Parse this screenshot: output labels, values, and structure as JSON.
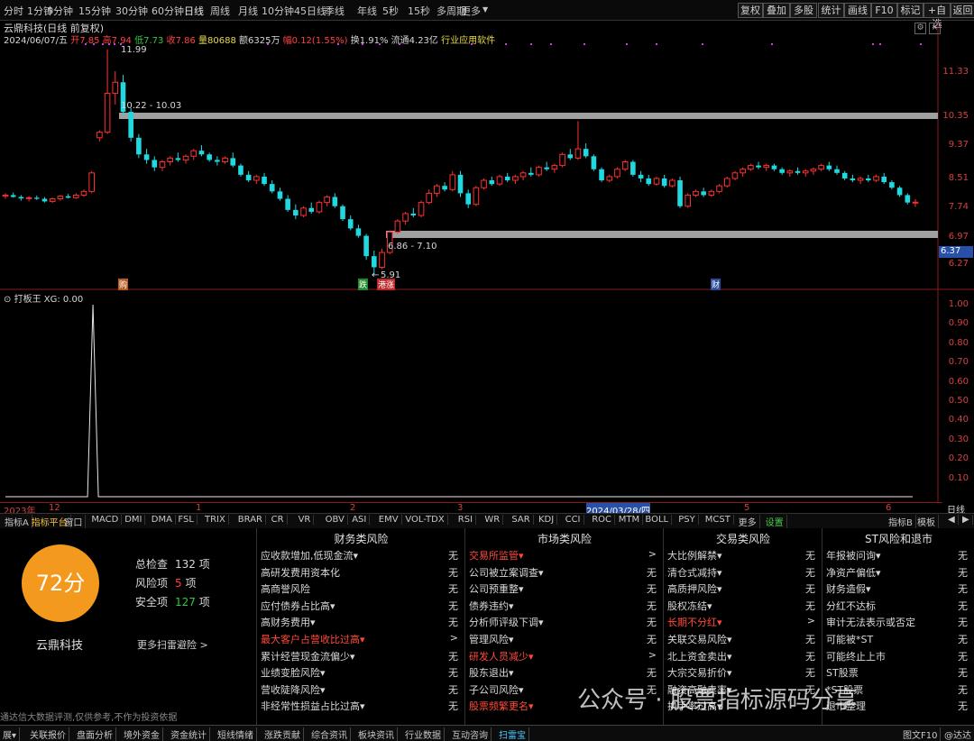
{
  "topbar": {
    "periods": [
      "分时",
      "1分钟",
      "5分钟",
      "15分钟",
      "30分钟",
      "60分钟",
      "日线",
      "周线",
      "月线",
      "10分钟",
      "45日线",
      "季线",
      "年线",
      "5秒",
      "15秒",
      "多周期",
      "更多"
    ],
    "active": "日线",
    "right_buttons": [
      "复权",
      "叠加",
      "多股",
      "统计",
      "画线",
      "F10",
      "标记",
      "+自选",
      "返回"
    ]
  },
  "info": {
    "title": "云鼎科技(日线 前复权)",
    "date": "2024/06/07/五",
    "open_label": "开",
    "open": "7.85",
    "high_label": "高",
    "high": "7.94",
    "low_label": "低",
    "low": "7.73",
    "close_label": "收",
    "close": "7.86",
    "vol_label": "量",
    "vol": "80688",
    "amt_label": "额",
    "amt": "6325万",
    "chg_label": "幅",
    "chg": "0.12(1.55%)",
    "turn_label": "换",
    "turn": "1.91%",
    "float_label": "流通",
    "float": "4.23亿",
    "industry": "行业应用软件"
  },
  "price_axis": [
    "11.33",
    "10.35",
    "9.37",
    "8.51",
    "7.74",
    "6.97",
    "6.27"
  ],
  "current_price_tag": "6.37",
  "annotations": {
    "high": "11.99",
    "upper_zone": "10.22 - 10.03",
    "lower_zone": "6.86 - 7.10",
    "low": "5.91"
  },
  "markers": [
    "购",
    "跌",
    "港涨",
    "财"
  ],
  "indicator": {
    "name": "打板王",
    "value": "XG: 0.00",
    "axis": [
      "1.00",
      "0.90",
      "0.80",
      "0.70",
      "0.60",
      "0.50",
      "0.40",
      "0.30",
      "0.20",
      "0.10"
    ]
  },
  "time_axis": [
    "2023年",
    "12",
    "1",
    "2",
    "3",
    "2024/03/28/四",
    "5",
    "6",
    "日线"
  ],
  "tabs": [
    "指标A",
    "指标平台",
    "窗口",
    "MACD",
    "DMI",
    "DMA",
    "FSL",
    "TRIX",
    "BRAR",
    "CR",
    "VR",
    "OBV",
    "ASI",
    "EMV",
    "VOL-TDX",
    "RSI",
    "WR",
    "SAR",
    "KDJ",
    "CCI",
    "ROC",
    "MTM",
    "BOLL",
    "PSY",
    "MCST",
    "更多",
    "设置"
  ],
  "tabs_right": [
    "指标B",
    "模板"
  ],
  "scan": {
    "score": "72分",
    "stock": "云鼎科技",
    "total_label": "总检查",
    "total": "132",
    "unit": "项",
    "risk_label": "风险项",
    "risk": "5",
    "safe_label": "安全项",
    "safe": "127",
    "more": "更多扫雷避险 >",
    "disclaimer": "通达信大数据评测,仅供参考,不作为投资依据"
  },
  "columns": [
    {
      "title": "财务类风险",
      "rows": [
        {
          "label": "应收款增加,低现金流▾",
          "val": "无",
          "hl": false
        },
        {
          "label": "高研发费用资本化",
          "val": "无",
          "hl": false
        },
        {
          "label": "高商誉风险",
          "val": "无",
          "hl": false
        },
        {
          "label": "应付债券占比高▾",
          "val": "无",
          "hl": false
        },
        {
          "label": "高财务费用▾",
          "val": "无",
          "hl": false
        },
        {
          "label": "最大客户占营收比过高▾",
          "val": ">",
          "hl": true
        },
        {
          "label": "累计经营现金流偏少▾",
          "val": "无",
          "hl": false
        },
        {
          "label": "业绩变脸风险▾",
          "val": "无",
          "hl": false
        },
        {
          "label": "营收陡降风险▾",
          "val": "无",
          "hl": false
        },
        {
          "label": "非经常性损益占比过高▾",
          "val": "无",
          "hl": false
        }
      ]
    },
    {
      "title": "市场类风险",
      "rows": [
        {
          "label": "交易所监管▾",
          "val": ">",
          "hl": true
        },
        {
          "label": "公司被立案调查▾",
          "val": "无",
          "hl": false
        },
        {
          "label": "公司预重整▾",
          "val": "无",
          "hl": false
        },
        {
          "label": "债券违约▾",
          "val": "无",
          "hl": false
        },
        {
          "label": "分析师评级下调▾",
          "val": "无",
          "hl": false
        },
        {
          "label": "管理风险▾",
          "val": "无",
          "hl": false
        },
        {
          "label": "研发人员减少▾",
          "val": ">",
          "hl": true
        },
        {
          "label": "股东退出▾",
          "val": "无",
          "hl": false
        },
        {
          "label": "子公司风险▾",
          "val": "无",
          "hl": false
        },
        {
          "label": "股票频繁更名▾",
          "val": "",
          "hl": true
        }
      ]
    },
    {
      "title": "交易类风险",
      "rows": [
        {
          "label": "大比例解禁▾",
          "val": "无",
          "hl": false
        },
        {
          "label": "清仓式减持▾",
          "val": "无",
          "hl": false
        },
        {
          "label": "高质押风险▾",
          "val": "无",
          "hl": false
        },
        {
          "label": "股权冻结▾",
          "val": "无",
          "hl": false
        },
        {
          "label": "长期不分红▾",
          "val": ">",
          "hl": true
        },
        {
          "label": "关联交易风险▾",
          "val": "无",
          "hl": false
        },
        {
          "label": "北上资金卖出▾",
          "val": "无",
          "hl": false
        },
        {
          "label": "大宗交易折价▾",
          "val": "无",
          "hl": false
        },
        {
          "label": "融资高融卖率▾",
          "val": "无",
          "hl": false
        },
        {
          "label": "换手率过高▾",
          "val": "",
          "hl": false
        }
      ]
    },
    {
      "title": "ST风险和退市",
      "rows": [
        {
          "label": "年报被问询▾",
          "val": "无",
          "hl": false
        },
        {
          "label": "净资产偏低▾",
          "val": "无",
          "hl": false
        },
        {
          "label": "财务造假▾",
          "val": "无",
          "hl": false
        },
        {
          "label": "分红不达标",
          "val": "无",
          "hl": false
        },
        {
          "label": "审计无法表示或否定",
          "val": "无",
          "hl": false
        },
        {
          "label": "可能被*ST",
          "val": "无",
          "hl": false
        },
        {
          "label": "可能终止上市",
          "val": "无",
          "hl": false
        },
        {
          "label": "ST股票",
          "val": "无",
          "hl": false
        },
        {
          "label": "*ST股票",
          "val": "无",
          "hl": false
        },
        {
          "label": "退市整理",
          "val": "无",
          "hl": false
        }
      ]
    }
  ],
  "bottombar": [
    "展▾",
    "关联报价",
    "盘面分析",
    "境外资金",
    "资金统计",
    "短线情绪",
    "涨跌贡献",
    "综合资讯",
    "板块资讯",
    "行业数据",
    "互动咨询",
    "扫雷宝"
  ],
  "bottombar_right": "图文F10",
  "bottombar_far": "@达达",
  "watermark": "公众号 · 股票指标源码分享",
  "colors": {
    "up": "#ff3030",
    "down": "#22d8e0",
    "accent": "#f39a1e"
  },
  "chart_data": {
    "type": "candlestick",
    "note_price_range": [
      5.91,
      11.99
    ],
    "candles": [
      [
        8.02,
        8.1,
        7.95,
        8.05
      ],
      [
        8.05,
        8.12,
        7.98,
        8.0
      ],
      [
        8.0,
        8.05,
        7.9,
        7.96
      ],
      [
        7.96,
        8.02,
        7.88,
        7.98
      ],
      [
        7.98,
        8.04,
        7.92,
        7.95
      ],
      [
        7.95,
        8.0,
        7.85,
        7.88
      ],
      [
        7.88,
        7.98,
        7.84,
        7.95
      ],
      [
        7.95,
        8.05,
        7.9,
        8.02
      ],
      [
        8.02,
        8.08,
        7.96,
        7.98
      ],
      [
        7.98,
        8.1,
        7.95,
        8.05
      ],
      [
        8.05,
        8.2,
        8.0,
        8.15
      ],
      [
        8.15,
        8.7,
        8.1,
        8.65
      ],
      [
        9.6,
        9.8,
        9.5,
        9.75
      ],
      [
        9.75,
        11.99,
        9.7,
        10.8
      ],
      [
        10.8,
        11.4,
        10.5,
        11.1
      ],
      [
        11.1,
        11.3,
        10.2,
        10.3
      ],
      [
        10.3,
        10.4,
        9.5,
        9.6
      ],
      [
        9.6,
        9.7,
        9.05,
        9.15
      ],
      [
        9.15,
        9.3,
        8.9,
        9.0
      ],
      [
        9.0,
        9.1,
        8.7,
        8.8
      ],
      [
        8.8,
        9.0,
        8.7,
        8.95
      ],
      [
        8.95,
        9.1,
        8.85,
        9.05
      ],
      [
        9.05,
        9.2,
        8.95,
        9.0
      ],
      [
        9.0,
        9.15,
        8.9,
        9.1
      ],
      [
        9.1,
        9.3,
        9.0,
        9.25
      ],
      [
        9.25,
        9.4,
        9.1,
        9.15
      ],
      [
        9.15,
        9.2,
        8.95,
        9.0
      ],
      [
        9.0,
        9.1,
        8.85,
        8.95
      ],
      [
        8.95,
        9.1,
        8.9,
        9.05
      ],
      [
        9.05,
        9.2,
        8.8,
        8.85
      ],
      [
        8.85,
        8.9,
        8.55,
        8.6
      ],
      [
        8.6,
        8.7,
        8.4,
        8.45
      ],
      [
        8.45,
        8.6,
        8.35,
        8.55
      ],
      [
        8.55,
        8.65,
        8.3,
        8.35
      ],
      [
        8.35,
        8.45,
        8.1,
        8.15
      ],
      [
        8.15,
        8.25,
        7.9,
        7.95
      ],
      [
        7.95,
        8.05,
        7.6,
        7.65
      ],
      [
        7.65,
        7.8,
        7.4,
        7.5
      ],
      [
        7.5,
        7.75,
        7.45,
        7.7
      ],
      [
        7.7,
        7.85,
        7.55,
        7.6
      ],
      [
        7.6,
        7.9,
        7.55,
        7.85
      ],
      [
        7.85,
        8.05,
        7.75,
        8.0
      ],
      [
        8.0,
        8.1,
        7.7,
        7.75
      ],
      [
        7.75,
        7.8,
        7.35,
        7.4
      ],
      [
        7.4,
        7.5,
        7.1,
        7.15
      ],
      [
        7.15,
        7.25,
        6.9,
        6.95
      ],
      [
        6.95,
        7.0,
        6.3,
        6.4
      ],
      [
        6.4,
        6.55,
        5.91,
        6.1
      ],
      [
        6.1,
        6.6,
        6.05,
        6.5
      ],
      [
        6.5,
        7.1,
        6.45,
        7.05
      ],
      [
        7.05,
        7.4,
        7.0,
        7.35
      ],
      [
        7.35,
        7.6,
        7.25,
        7.55
      ],
      [
        7.55,
        7.7,
        7.45,
        7.5
      ],
      [
        7.5,
        7.9,
        7.45,
        7.85
      ],
      [
        7.85,
        8.2,
        7.8,
        8.1
      ],
      [
        8.1,
        8.35,
        8.0,
        8.3
      ],
      [
        8.3,
        8.4,
        8.15,
        8.2
      ],
      [
        8.2,
        8.7,
        8.15,
        8.6
      ],
      [
        8.6,
        8.7,
        8.0,
        8.1
      ],
      [
        8.1,
        8.2,
        7.7,
        7.8
      ],
      [
        7.8,
        8.3,
        7.75,
        8.25
      ],
      [
        8.25,
        8.5,
        8.2,
        8.45
      ],
      [
        8.45,
        8.55,
        8.3,
        8.35
      ],
      [
        8.35,
        8.6,
        8.3,
        8.55
      ],
      [
        8.55,
        8.65,
        8.4,
        8.45
      ],
      [
        8.45,
        8.6,
        8.35,
        8.55
      ],
      [
        8.55,
        8.7,
        8.45,
        8.65
      ],
      [
        8.65,
        8.8,
        8.55,
        8.6
      ],
      [
        8.6,
        8.85,
        8.55,
        8.8
      ],
      [
        8.8,
        8.95,
        8.7,
        8.75
      ],
      [
        8.75,
        8.9,
        8.65,
        8.85
      ],
      [
        8.85,
        9.2,
        8.8,
        9.15
      ],
      [
        9.15,
        9.3,
        9.0,
        9.05
      ],
      [
        9.05,
        10.05,
        9.0,
        9.3
      ],
      [
        9.3,
        9.45,
        9.05,
        9.1
      ],
      [
        9.1,
        9.15,
        8.7,
        8.75
      ],
      [
        8.75,
        8.8,
        8.4,
        8.45
      ],
      [
        8.45,
        8.6,
        8.4,
        8.55
      ],
      [
        8.55,
        8.8,
        8.5,
        8.75
      ],
      [
        8.75,
        9.0,
        8.7,
        8.95
      ],
      [
        8.95,
        9.0,
        8.55,
        8.6
      ],
      [
        8.6,
        8.7,
        8.4,
        8.5
      ],
      [
        8.5,
        8.6,
        8.3,
        8.35
      ],
      [
        8.35,
        8.55,
        8.3,
        8.5
      ],
      [
        8.5,
        8.6,
        8.25,
        8.3
      ],
      [
        8.3,
        8.5,
        8.25,
        8.45
      ],
      [
        8.45,
        8.55,
        7.7,
        7.75
      ],
      [
        7.75,
        8.1,
        7.7,
        8.05
      ],
      [
        8.05,
        8.2,
        8.0,
        8.15
      ],
      [
        8.15,
        8.25,
        8.0,
        8.05
      ],
      [
        8.05,
        8.2,
        8.0,
        8.15
      ],
      [
        8.15,
        8.35,
        8.1,
        8.3
      ],
      [
        8.3,
        8.55,
        8.25,
        8.5
      ],
      [
        8.5,
        8.7,
        8.45,
        8.65
      ],
      [
        8.65,
        8.8,
        8.55,
        8.75
      ],
      [
        8.75,
        8.9,
        8.7,
        8.85
      ],
      [
        8.85,
        8.95,
        8.75,
        8.8
      ],
      [
        8.8,
        8.9,
        8.7,
        8.85
      ],
      [
        8.85,
        8.9,
        8.7,
        8.75
      ],
      [
        8.75,
        8.8,
        8.6,
        8.65
      ],
      [
        8.65,
        8.75,
        8.55,
        8.7
      ],
      [
        8.7,
        8.8,
        8.6,
        8.65
      ],
      [
        8.65,
        8.75,
        8.55,
        8.7
      ],
      [
        8.7,
        8.8,
        8.6,
        8.75
      ],
      [
        8.75,
        8.9,
        8.7,
        8.85
      ],
      [
        8.85,
        8.95,
        8.7,
        8.75
      ],
      [
        8.75,
        8.85,
        8.6,
        8.65
      ],
      [
        8.65,
        8.7,
        8.45,
        8.5
      ],
      [
        8.5,
        8.6,
        8.4,
        8.45
      ],
      [
        8.45,
        8.55,
        8.35,
        8.5
      ],
      [
        8.5,
        8.6,
        8.4,
        8.45
      ],
      [
        8.45,
        8.6,
        8.4,
        8.55
      ],
      [
        8.55,
        8.65,
        8.35,
        8.4
      ],
      [
        8.4,
        8.45,
        8.2,
        8.25
      ],
      [
        8.25,
        8.3,
        8.0,
        8.05
      ],
      [
        8.05,
        8.1,
        7.8,
        7.85
      ],
      [
        7.85,
        7.94,
        7.73,
        7.86
      ]
    ],
    "indicator_series": {
      "name": "XG",
      "spike_index": 13,
      "values_range": [
        0,
        1
      ]
    }
  }
}
